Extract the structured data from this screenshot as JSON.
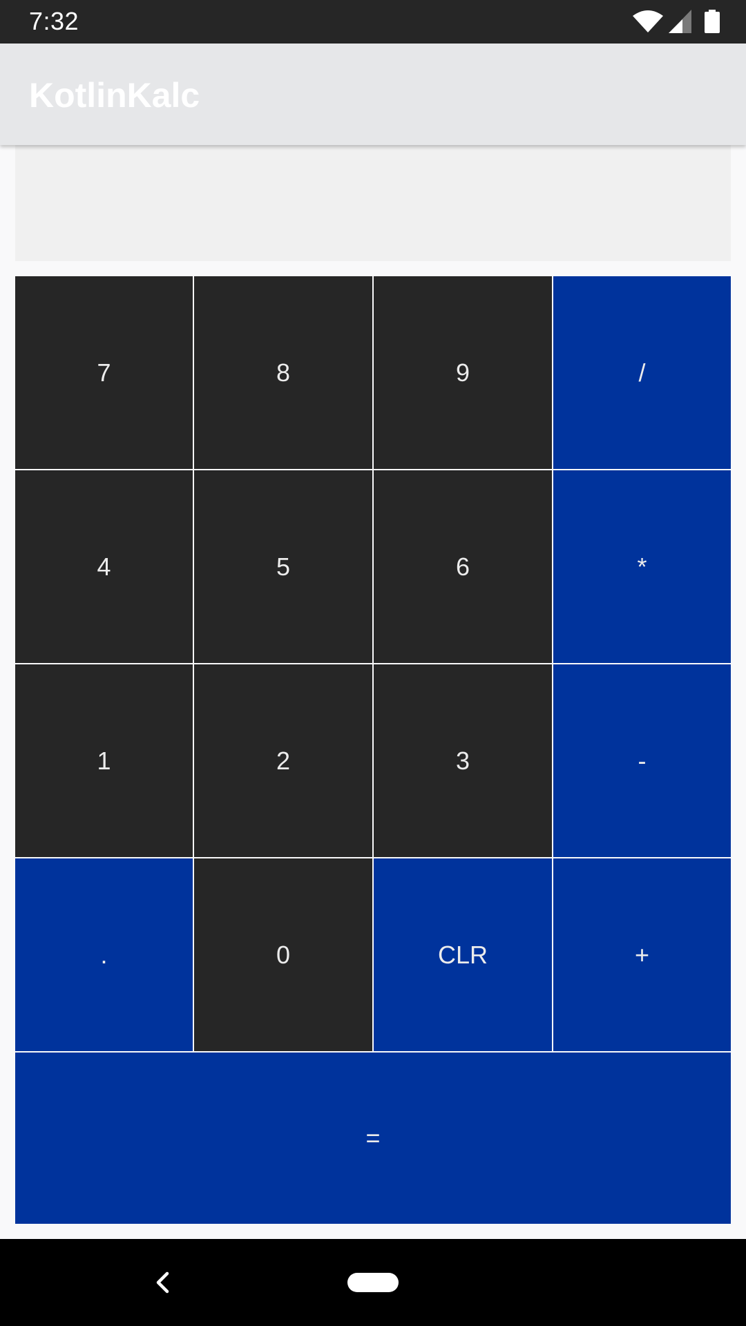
{
  "status_bar": {
    "time": "7:32",
    "icons": [
      "wifi-icon",
      "signal-icon",
      "battery-icon"
    ]
  },
  "app_bar": {
    "title": "KotlinKalc"
  },
  "display": {
    "value": ""
  },
  "keypad": {
    "keys": [
      {
        "label": "7",
        "style": "dark"
      },
      {
        "label": "8",
        "style": "dark"
      },
      {
        "label": "9",
        "style": "dark"
      },
      {
        "label": "/",
        "style": "operator"
      },
      {
        "label": "4",
        "style": "dark"
      },
      {
        "label": "5",
        "style": "dark"
      },
      {
        "label": "6",
        "style": "dark"
      },
      {
        "label": "*",
        "style": "operator"
      },
      {
        "label": "1",
        "style": "dark"
      },
      {
        "label": "2",
        "style": "dark"
      },
      {
        "label": "3",
        "style": "dark"
      },
      {
        "label": "-",
        "style": "operator"
      },
      {
        "label": ".",
        "style": "operator"
      },
      {
        "label": "0",
        "style": "dark"
      },
      {
        "label": "CLR",
        "style": "operator"
      },
      {
        "label": "+",
        "style": "operator"
      },
      {
        "label": "=",
        "style": "operator"
      }
    ]
  },
  "nav_bar": {
    "icons": [
      "back-icon",
      "home-pill-icon"
    ]
  },
  "colors": {
    "key_dark": "#262626",
    "key_operator": "#00339C",
    "app_bar": "#E6E7E9",
    "display_bg": "#F0F0F0",
    "key_text": "#ECECEC"
  }
}
